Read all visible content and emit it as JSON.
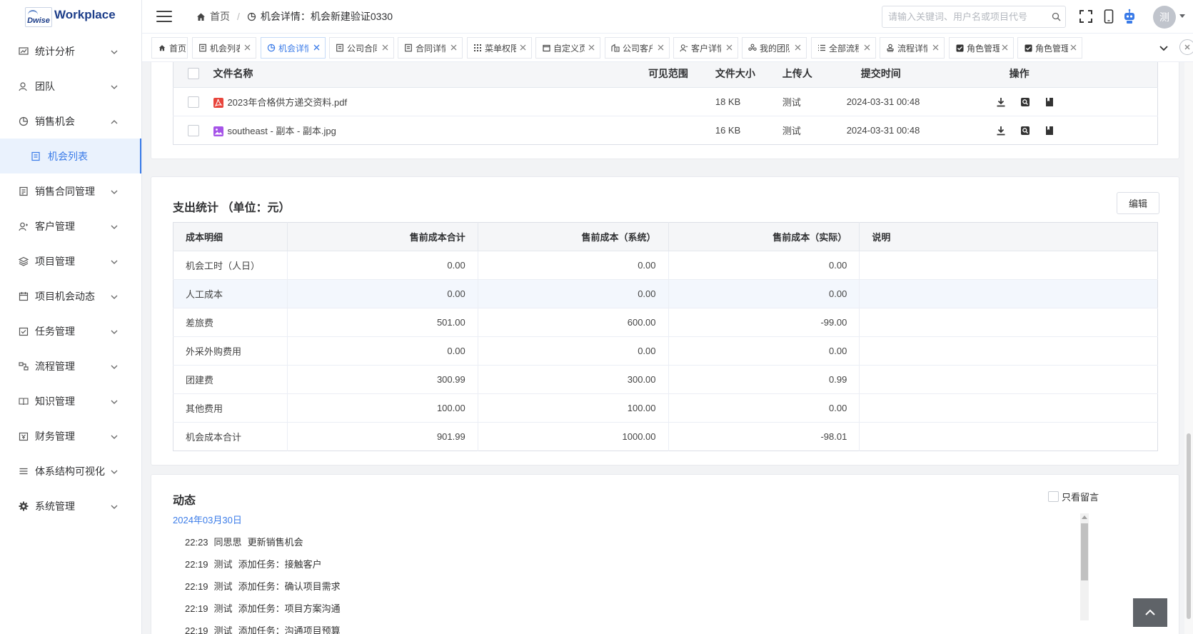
{
  "logo": {
    "mark": "Dwise",
    "name": "Workplace"
  },
  "sidebar": {
    "items": [
      {
        "label": "统计分析"
      },
      {
        "label": "团队"
      },
      {
        "label": "销售机会"
      },
      {
        "label": "机会列表"
      },
      {
        "label": "销售合同管理"
      },
      {
        "label": "客户管理"
      },
      {
        "label": "项目管理"
      },
      {
        "label": "项目机会动态"
      },
      {
        "label": "任务管理"
      },
      {
        "label": "流程管理"
      },
      {
        "label": "知识管理"
      },
      {
        "label": "财务管理"
      },
      {
        "label": "体系结构可视化"
      },
      {
        "label": "系统管理"
      }
    ]
  },
  "header": {
    "breadcrumb_home": "首页",
    "breadcrumb_separator": "/",
    "breadcrumb_current": "机会详情：机会新建验证0330",
    "search_placeholder": "请输入关键词、用户名或项目代号",
    "avatar": "测"
  },
  "tabs": [
    {
      "label": "首页",
      "icon": "home-icon",
      "closable": false
    },
    {
      "label": "机会列表",
      "icon": "list-icon",
      "closable": true
    },
    {
      "label": "机会详情",
      "icon": "chart-icon",
      "closable": true,
      "active": true
    },
    {
      "label": "公司合同",
      "icon": "document-icon",
      "closable": true
    },
    {
      "label": "合同详情",
      "icon": "document-icon",
      "closable": true
    },
    {
      "label": "菜单权限",
      "icon": "grid-icon",
      "closable": true
    },
    {
      "label": "自定义页",
      "icon": "window-icon",
      "closable": true
    },
    {
      "label": "公司客户",
      "icon": "building-icon",
      "closable": true
    },
    {
      "label": "客户详情",
      "icon": "user-icon",
      "closable": true
    },
    {
      "label": "我的团队",
      "icon": "team-icon",
      "closable": true
    },
    {
      "label": "全部流程",
      "icon": "list-icon",
      "closable": true
    },
    {
      "label": "流程详情",
      "icon": "stamp-icon",
      "closable": true
    },
    {
      "label": "角色管理",
      "icon": "check-icon",
      "closable": true
    },
    {
      "label": "角色管理",
      "icon": "check-icon",
      "closable": true
    }
  ],
  "files": {
    "columns": [
      "文件名称",
      "可见范围",
      "文件大小",
      "上传人",
      "提交时间",
      "操作"
    ],
    "rows": [
      {
        "name": "2023年合格供方递交资料.pdf",
        "type": "pdf",
        "scope": "",
        "size": "18 KB",
        "uploader": "测试",
        "time": "2024-03-31 00:48"
      },
      {
        "name": "southeast - 副本 - 副本.jpg",
        "type": "image",
        "scope": "",
        "size": "16 KB",
        "uploader": "测试",
        "time": "2024-03-31 00:48"
      }
    ]
  },
  "cost": {
    "title": "支出统计 （单位：元）",
    "edit_label": "编辑",
    "columns": [
      "成本明细",
      "售前成本合计",
      "售前成本（系统）",
      "售前成本（实际）",
      "说明"
    ],
    "rows": [
      [
        "机会工时（人日）",
        "0.00",
        "0.00",
        "0.00",
        ""
      ],
      [
        "人工成本",
        "0.00",
        "0.00",
        "0.00",
        ""
      ],
      [
        "差旅费",
        "501.00",
        "600.00",
        "-99.00",
        ""
      ],
      [
        "外采外购费用",
        "0.00",
        "0.00",
        "0.00",
        ""
      ],
      [
        "团建费",
        "300.99",
        "300.00",
        "0.99",
        ""
      ],
      [
        "其他费用",
        "100.00",
        "100.00",
        "0.00",
        ""
      ],
      [
        "机会成本合计",
        "901.99",
        "1000.00",
        "-98.01",
        ""
      ]
    ]
  },
  "activity": {
    "title": "动态",
    "filter_label": "只看留言",
    "date": "2024年03月30日",
    "items": [
      {
        "time": "22:23",
        "user": "同思思",
        "action": "更新销售机会"
      },
      {
        "time": "22:19",
        "user": "测试",
        "action": "添加任务：接触客户"
      },
      {
        "time": "22:19",
        "user": "测试",
        "action": "添加任务：确认项目需求"
      },
      {
        "time": "22:19",
        "user": "测试",
        "action": "添加任务：项目方案沟通"
      },
      {
        "time": "22:19",
        "user": "测试",
        "action": "添加任务：沟通项目预算"
      }
    ]
  },
  "colors": {
    "accent": "#3a7be8",
    "pdf": "#e8453c",
    "image": "#a654e8"
  }
}
